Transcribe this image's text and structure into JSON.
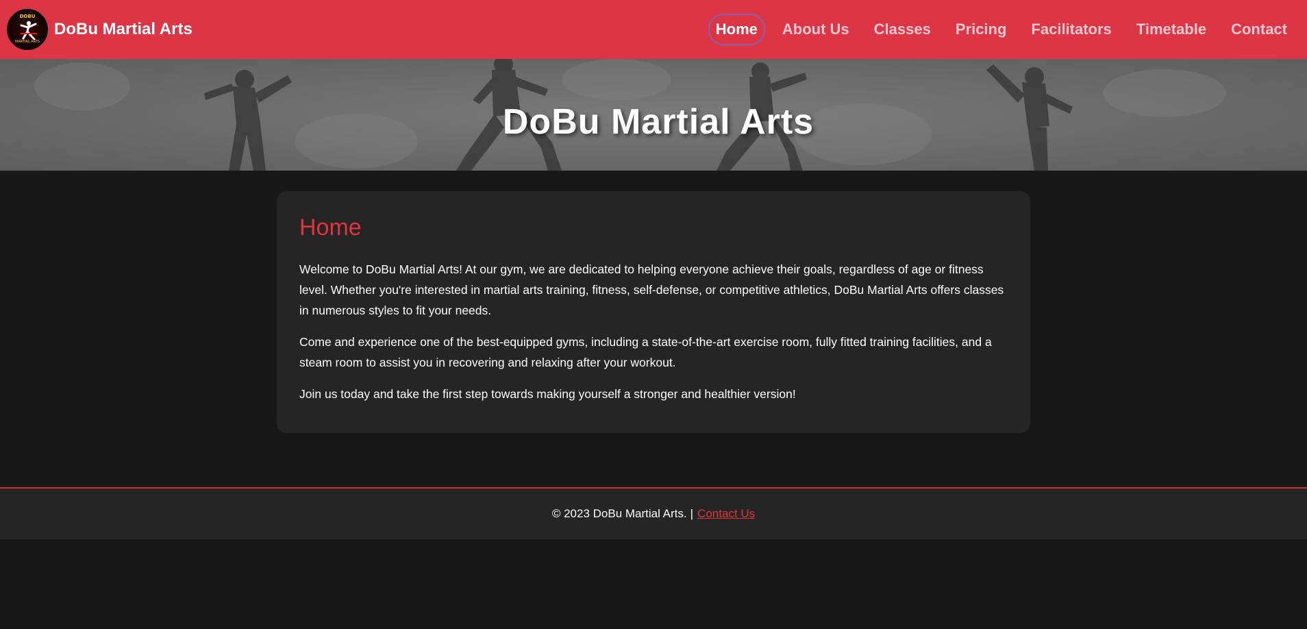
{
  "brand": {
    "name": "DoBu Martial Arts",
    "logo_top_text": "DOBU",
    "logo_bottom_text": "MARTIAL ARTS"
  },
  "nav": {
    "items": [
      {
        "label": "Home",
        "active": true
      },
      {
        "label": "About Us"
      },
      {
        "label": "Classes"
      },
      {
        "label": "Pricing"
      },
      {
        "label": "Facilitators"
      },
      {
        "label": "Timetable"
      },
      {
        "label": "Contact"
      }
    ]
  },
  "hero": {
    "title": "DoBu Martial Arts"
  },
  "main": {
    "heading": "Home",
    "paragraphs": [
      "Welcome to DoBu Martial Arts! At our gym, we are dedicated to helping everyone achieve their goals, regardless of age or fitness level. Whether you're interested in martial arts training, fitness, self-defense, or competitive athletics, DoBu Martial Arts offers classes in numerous styles to fit your needs.",
      "Come and experience one of the best-equipped gyms, including a state-of-the-art exercise room, fully fitted training facilities, and a steam room to assist you in recovering and relaxing after your workout.",
      "Join us today and take the first step towards making yourself a stronger and healthier version!"
    ]
  },
  "footer": {
    "copyright": "© 2023 DoBu Martial Arts.",
    "separator": "|",
    "contact_link": "Contact Us"
  },
  "colors": {
    "navbar": "#dc3545",
    "accent": "#e0353f",
    "page_bg": "#181818",
    "card_bg": "#252525"
  }
}
